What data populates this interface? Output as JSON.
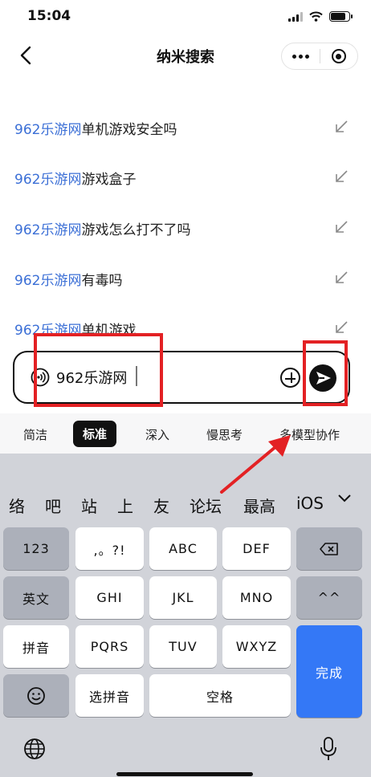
{
  "status": {
    "time": "15:04"
  },
  "nav": {
    "title": "纳米搜索"
  },
  "suggestions": [
    {
      "highlight": "962乐游网",
      "rest": "单机游戏安全吗"
    },
    {
      "highlight": "962乐游网",
      "rest": "游戏盒子"
    },
    {
      "highlight": "962乐游网",
      "rest": "游戏怎么打不了吗"
    },
    {
      "highlight": "962乐游网",
      "rest": "有毒吗"
    },
    {
      "highlight": "962乐游网",
      "rest": "单机游戏"
    }
  ],
  "input": {
    "value": "962乐游网"
  },
  "modes": [
    "简洁",
    "标准",
    "深入",
    "慢思考",
    "多模型协作"
  ],
  "active_mode": "标准",
  "keyboard": {
    "candidates": [
      "络",
      "吧",
      "站",
      "上",
      "友",
      "论坛",
      "最高",
      "iOS"
    ],
    "row1": [
      "123",
      ",。?!",
      "ABC",
      "DEF"
    ],
    "row2": [
      "英文",
      "GHI",
      "JKL",
      "MNO",
      "^^"
    ],
    "row3": [
      "拼音",
      "PQRS",
      "TUV",
      "WXYZ"
    ],
    "row4": [
      "选拼音",
      "空格"
    ],
    "done": "完成"
  },
  "colors": {
    "highlight": "#3b6fd6",
    "annotation": "#e32124",
    "done_key": "#3478f6"
  },
  "icons": [
    "back-arrow-icon",
    "more-dots-icon",
    "target-icon",
    "voice-icon",
    "plus-icon",
    "send-icon",
    "fill-arrow-icon",
    "backspace-icon",
    "emoji-icon",
    "globe-icon",
    "mic-icon",
    "chevron-down-icon"
  ]
}
